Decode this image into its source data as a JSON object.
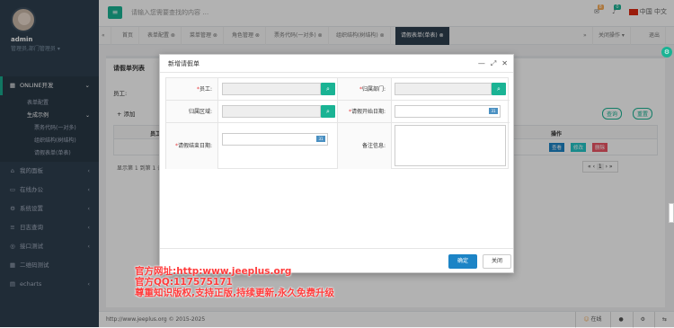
{
  "sidebar": {
    "username": "admin",
    "role": "管理员,部门管理员 ▾",
    "menu": [
      {
        "label": "ONLINE开发"
      },
      {
        "label": "表单配置"
      },
      {
        "label": "生成示例"
      },
      {
        "label": "票务代码(一对多)"
      },
      {
        "label": "组织结构(树结构)"
      },
      {
        "label": "请假表单(单表)"
      },
      {
        "label": "我的面板"
      },
      {
        "label": "在线办公"
      },
      {
        "label": "系统设置"
      },
      {
        "label": "日志查询"
      },
      {
        "label": "接口测试"
      },
      {
        "label": "二维码测试"
      },
      {
        "label": "echarts"
      }
    ]
  },
  "topbar": {
    "search_placeholder": "请输入您需要查找的内容 …",
    "mail_count": "8",
    "bell_count": "0",
    "lang": "中国 中文"
  },
  "tabs": [
    {
      "label": "首页"
    },
    {
      "label": "表单配置"
    },
    {
      "label": "菜单管理"
    },
    {
      "label": "角色管理"
    },
    {
      "label": "票务代码(一对多)"
    },
    {
      "label": "组织结构(树结构)"
    },
    {
      "label": "请假表单(单表)"
    },
    {
      "label": "关闭操作 ▾"
    },
    {
      "label": "退出"
    }
  ],
  "page": {
    "title": "请假单列表",
    "emp_label": "员工:",
    "add_label": "添加",
    "edit_label": "修改",
    "col_emp": "员工",
    "col_op": "操作",
    "op_view": "查看",
    "op_edit": "修改",
    "op_del": "删除",
    "query": "查询",
    "reset": "重置",
    "pager_info": "显示第 1 到第 1 条",
    "page_num": "1"
  },
  "modal": {
    "title": "新增请假单",
    "emp_label": "员工:",
    "dept_label": "归属部门:",
    "area_label": "归属区域:",
    "start_label": "请假开始日期:",
    "end_label": "请假结束日期:",
    "remark_label": "备注信息:",
    "ok": "确定",
    "close": "关闭"
  },
  "footer": {
    "copyright": "http://www.jeeplus.org © 2015-2025",
    "status": "在线"
  },
  "watermark": {
    "line1": "官方网址:http:www.jeeplus.org",
    "line2": "官方QQ:117575171",
    "line3": "尊重知识版权,支持正版,持续更新,永久免费升级"
  }
}
